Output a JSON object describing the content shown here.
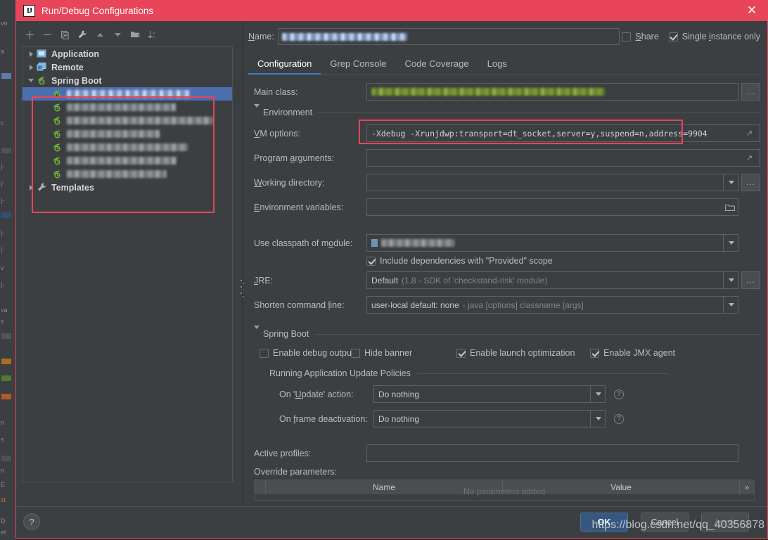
{
  "window": {
    "title": "Run/Debug Configurations",
    "app_icon": "intellij-idea-logo-icon",
    "close_icon": "close-icon"
  },
  "toolbar": {
    "buttons": [
      {
        "name": "add-configuration-button",
        "icon": "plus-icon",
        "label": "+"
      },
      {
        "name": "remove-configuration-button",
        "icon": "minus-icon",
        "label": "−"
      },
      {
        "name": "copy-configuration-button",
        "icon": "copy-icon",
        "label": "Copy"
      },
      {
        "name": "edit-templates-button",
        "icon": "wrench-icon",
        "label": "Edit Templates"
      },
      {
        "name": "move-up-button",
        "icon": "arrow-up-icon",
        "label": "Move Up"
      },
      {
        "name": "move-down-button",
        "icon": "arrow-down-icon",
        "label": "Move Down"
      },
      {
        "name": "new-folder-button",
        "icon": "new-folder-icon",
        "label": "New Folder"
      },
      {
        "name": "sort-configurations-button",
        "icon": "sort-az-icon",
        "label": "Sort Configurations"
      }
    ]
  },
  "tree": {
    "nodes": [
      {
        "label": "Application",
        "icon": "application-icon",
        "expanded": false,
        "bold": true,
        "indent": 0,
        "redacted": false
      },
      {
        "label": "Remote",
        "icon": "remote-icon",
        "expanded": false,
        "bold": true,
        "indent": 0,
        "redacted": false
      },
      {
        "label": "Spring Boot",
        "icon": "spring-boot-icon",
        "expanded": true,
        "bold": true,
        "indent": 0,
        "redacted": false
      },
      {
        "label": "",
        "icon": "spring-boot-icon",
        "indent": 1,
        "redacted": true,
        "selected": true,
        "redact_width": 175,
        "redact_style": "blue"
      },
      {
        "label": "",
        "icon": "spring-boot-icon",
        "indent": 1,
        "redacted": true,
        "redact_width": 155
      },
      {
        "label": "",
        "icon": "spring-boot-icon",
        "indent": 1,
        "redacted": true,
        "redact_width": 208
      },
      {
        "label": "",
        "icon": "spring-boot-icon",
        "indent": 1,
        "redacted": true,
        "redact_width": 132
      },
      {
        "label": "",
        "icon": "spring-boot-icon",
        "indent": 1,
        "redacted": true,
        "redact_width": 172
      },
      {
        "label": "",
        "icon": "spring-boot-icon",
        "indent": 1,
        "redacted": true,
        "redact_width": 156
      },
      {
        "label": "",
        "icon": "spring-boot-icon",
        "indent": 1,
        "redacted": true,
        "redact_width": 142
      },
      {
        "label": "Templates",
        "icon": "wrench-icon",
        "expanded": false,
        "bold": true,
        "indent": 0,
        "redacted": false
      }
    ]
  },
  "name_row": {
    "label": "Name:",
    "value": "",
    "value_redacted": true,
    "share": {
      "label": "Share",
      "checked": false
    },
    "single_instance": {
      "label": "Single instance only",
      "checked": true
    }
  },
  "tabs": [
    {
      "label": "Configuration",
      "active": true
    },
    {
      "label": "Grep Console",
      "active": false
    },
    {
      "label": "Code Coverage",
      "active": false
    },
    {
      "label": "Logs",
      "active": false
    }
  ],
  "form": {
    "main_class": {
      "label": "Main class:",
      "value": "",
      "value_redacted": true,
      "browse_label": "..."
    },
    "environment_group": {
      "label": "Environment",
      "expanded": true
    },
    "vm_options": {
      "label": "VM options:",
      "value": "-Xdebug -Xrunjdwp:transport=dt_socket,server=y,suspend=n,address=9904",
      "highlighted": true,
      "expand_icon": "expand-editor-icon"
    },
    "program_arguments": {
      "label": "Program arguments:",
      "value": "",
      "expand_icon": "expand-editor-icon"
    },
    "working_directory": {
      "label": "Working directory:",
      "value": "",
      "dropdown_icon": "chevron-down-icon",
      "browse_label": "..."
    },
    "environment_variables": {
      "label": "Environment variables:",
      "value": "",
      "folder_icon": "folder-icon"
    },
    "use_classpath_of_module": {
      "label": "Use classpath of module:",
      "value": "",
      "value_redacted": true,
      "dropdown_icon": "chevron-down-icon"
    },
    "include_provided": {
      "label": "Include dependencies with \"Provided\" scope",
      "checked": true
    },
    "jre": {
      "label": "JRE:",
      "value": "Default",
      "value_hint": "(1.8 - SDK of 'checkstand-risk' module)",
      "dropdown_icon": "chevron-down-icon",
      "browse_label": "..."
    },
    "shorten_command_line": {
      "label": "Shorten command line:",
      "value": "user-local default: none",
      "value_hint": "- java [options] classname [args]",
      "dropdown_icon": "chevron-down-icon"
    },
    "spring_boot_group": {
      "label": "Spring Boot",
      "expanded": true
    },
    "spring_checkboxes": [
      {
        "label": "Enable debug output",
        "checked": false,
        "name": "enable-debug-output-checkbox"
      },
      {
        "label": "Hide banner",
        "checked": false,
        "name": "hide-banner-checkbox"
      },
      {
        "label": "Enable launch optimization",
        "checked": true,
        "name": "enable-launch-optimization-checkbox"
      },
      {
        "label": "Enable JMX agent",
        "checked": true,
        "name": "enable-jmx-agent-checkbox"
      }
    ],
    "update_policies_group": {
      "label": "Running Application Update Policies"
    },
    "on_update_action": {
      "label": "On 'Update' action:",
      "value": "Do nothing",
      "dropdown_icon": "chevron-down-icon",
      "help_icon": "help-icon"
    },
    "on_frame_deactivation": {
      "label": "On frame deactivation:",
      "value": "Do nothing",
      "dropdown_icon": "chevron-down-icon",
      "help_icon": "help-icon"
    },
    "active_profiles": {
      "label": "Active profiles:",
      "value": ""
    },
    "override_parameters": {
      "label": "Override parameters:",
      "columns": [
        "Name",
        "Value"
      ],
      "empty_text": "No parameters added",
      "more_label": "»",
      "rows": []
    }
  },
  "footer": {
    "help_label": "?",
    "buttons": [
      {
        "label": "OK",
        "name": "ok-button",
        "style": "primary",
        "disabled": false
      },
      {
        "label": "Cancel",
        "name": "cancel-button",
        "style": "normal",
        "disabled": false
      },
      {
        "label": "Apply",
        "name": "apply-button",
        "style": "normal",
        "disabled": true
      }
    ]
  },
  "watermark": {
    "text": "https://blog.csdn.net/qq_40356878"
  },
  "colors": {
    "title_bar": "#e8445a",
    "dialog_bg": "#3c3f41",
    "selection": "#4b6eaf",
    "accent_tab": "#3d7ecc",
    "primary_button": "#365880",
    "highlight_box": "#e8445a",
    "text": "#bbbbbb"
  }
}
